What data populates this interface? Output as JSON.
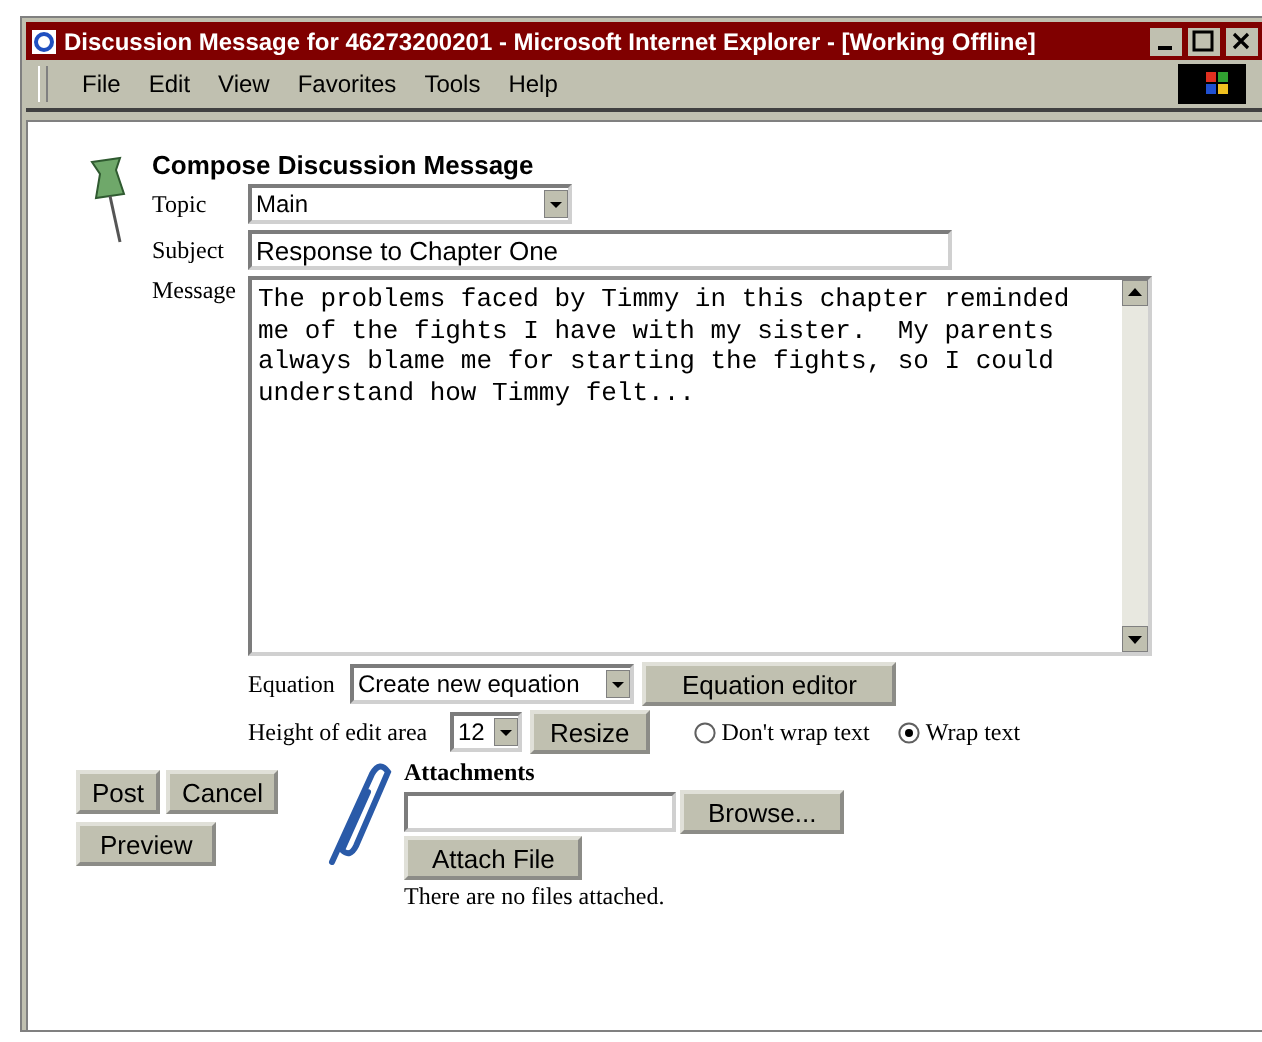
{
  "window": {
    "title": "Discussion Message for 46273200201 - Microsoft Internet Explorer - [Working Offline]"
  },
  "menu": [
    {
      "label": "File"
    },
    {
      "label": "Edit"
    },
    {
      "label": "View"
    },
    {
      "label": "Favorites"
    },
    {
      "label": "Tools"
    },
    {
      "label": "Help"
    }
  ],
  "form": {
    "heading": "Compose Discussion Message",
    "topic": {
      "label": "Topic",
      "value": "Main"
    },
    "subject": {
      "label": "Subject",
      "value": "Response to Chapter One"
    },
    "message": {
      "label": "Message",
      "value": "The problems faced by Timmy in this chapter reminded me of the fights I have with my sister.  My parents always blame me for starting the fights, so I could understand how Timmy felt..."
    },
    "equation": {
      "label": "Equation",
      "value": "Create new equation",
      "button": "Equation editor"
    },
    "edit_height": {
      "label": "Height of edit area",
      "value": "12",
      "button": "Resize"
    },
    "wrap_options": [
      {
        "label": "Don't wrap text",
        "selected": false
      },
      {
        "label": "Wrap text",
        "selected": true
      }
    ],
    "actions": [
      "Post",
      "Cancel",
      "Preview"
    ],
    "attachments": {
      "heading": "Attachments",
      "browse_button": "Browse...",
      "attach_button": "Attach File",
      "status": "There are no files attached."
    }
  }
}
